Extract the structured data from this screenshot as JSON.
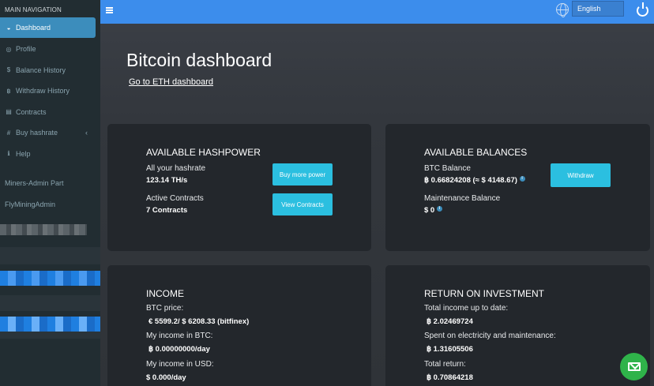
{
  "sidebar": {
    "header": "MAIN NAVIGATION",
    "items": [
      {
        "label": "Dashboard",
        "icon": "dashboard-icon",
        "glyph": "◒",
        "active": true
      },
      {
        "label": "Profile",
        "icon": "user-circle-icon",
        "glyph": "◎"
      },
      {
        "label": "Balance History",
        "icon": "dollar-icon",
        "glyph": "$"
      },
      {
        "label": "Withdraw History",
        "icon": "bitcoin-icon",
        "glyph": "฿"
      },
      {
        "label": "Contracts",
        "icon": "document-icon",
        "glyph": "▤"
      },
      {
        "label": "Buy hashrate",
        "icon": "hashtag-icon",
        "glyph": "#",
        "chevron": "‹"
      },
      {
        "label": "Help",
        "icon": "info-icon",
        "glyph": "ℹ"
      }
    ],
    "admin_links": [
      "Miners-Admin Part",
      "FlyMiningAdmin"
    ]
  },
  "topbar": {
    "language": "English",
    "colors": {
      "bar": "#3c8dec",
      "fab": "#2fb34a",
      "accent": "#2bbfe0"
    }
  },
  "main": {
    "title": "Bitcoin dashboard",
    "eth_link": "Go to ETH dashboard"
  },
  "hashpower": {
    "title": "AVAILABLE HASHPOWER",
    "hashrate_label": "All your hashrate",
    "hashrate_value": "123.14 TH/s",
    "contracts_label": "Active Contracts",
    "contracts_value": "7 Contracts",
    "buy_button": "Buy more power",
    "view_button": "View Contracts"
  },
  "balances": {
    "title": "AVAILABLE BALANCES",
    "btc_label": "BTC Balance",
    "btc_value": "฿ 0.66824208 (≈ $ 4148.67)",
    "maintenance_label": "Maintenance Balance",
    "maintenance_value": "$ 0",
    "withdraw_button": "Withdraw"
  },
  "income": {
    "title": "INCOME",
    "price_label": "BTC price:",
    "price_value": "€ 5599.2/ $ 6208.33 (bitfinex)",
    "btc_income_label": "My income in BTC:",
    "btc_income_value": "฿ 0.00000000/day",
    "usd_income_label": "My income in USD:",
    "usd_income_value": "$ 0.000/day"
  },
  "roi": {
    "title": "RETURN ON INVESTMENT",
    "total_income_label": "Total income up to date:",
    "total_income_value": "฿ 2.02469724",
    "spent_label": "Spent on electricity and maintenance:",
    "spent_value": "฿ 1.31605506",
    "total_return_label": "Total return:",
    "total_return_value": "฿ 0.70864218"
  }
}
